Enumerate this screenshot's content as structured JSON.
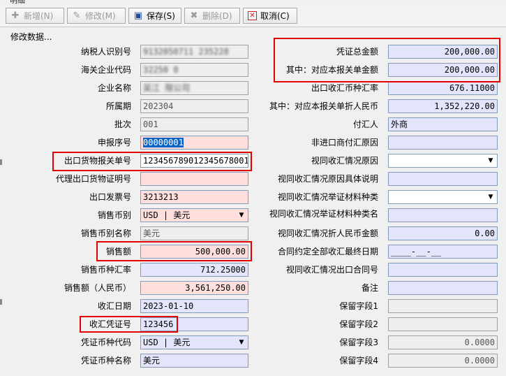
{
  "window": {
    "title": "明细"
  },
  "toolbar": {
    "add_label": "新增(N)",
    "edit_label": "修改(M)",
    "save_label": "保存(S)",
    "delete_label": "删除(D)",
    "cancel_label": "取消(C)"
  },
  "caption": "修改数据...",
  "left": {
    "taxpayer_id": {
      "label": "纳税人识别号",
      "value": "9132050711 235228"
    },
    "customs_code": {
      "label": "海关企业代码",
      "value": "32250 0"
    },
    "company_name": {
      "label": "企业名称",
      "value": "吴江 限公司"
    },
    "period": {
      "label": "所属期",
      "value": "202304"
    },
    "batch": {
      "label": "批次",
      "value": "001"
    },
    "declare_no": {
      "label": "申报序号",
      "value": "00000001"
    },
    "export_declaration_no": {
      "label": "出口货物报关单号",
      "value": "123456789012345678001"
    },
    "agent_cert_no": {
      "label": "代理出口货物证明号",
      "value": ""
    },
    "invoice_no": {
      "label": "出口发票号",
      "value": "3213213"
    },
    "sales_currency": {
      "label": "销售币别",
      "value": "USD | 美元"
    },
    "sales_currency_name": {
      "label": "销售币别名称",
      "value": "美元"
    },
    "sales_amount": {
      "label": "销售额",
      "value": "500,000.00"
    },
    "sales_rate": {
      "label": "销售币种汇率",
      "value": "712.25000"
    },
    "sales_amount_rmb": {
      "label": "销售额（人民币）",
      "value": "3,561,250.00"
    },
    "collection_date": {
      "label": "收汇日期",
      "value": "2023-01-10"
    },
    "collection_voucher": {
      "label": "收汇凭证号",
      "value": "123456"
    },
    "voucher_currency": {
      "label": "凭证币种代码",
      "value": "USD | 美元"
    },
    "voucher_currency_name": {
      "label": "凭证币种名称",
      "value": "美元"
    }
  },
  "right": {
    "voucher_total": {
      "label": "凭证总金额",
      "value": "200,000.00"
    },
    "declaration_amount": {
      "label": "其中：对应本报关单金额",
      "value": "200,000.00"
    },
    "export_rate": {
      "label": "出口收汇币种汇率",
      "value": "676.11000"
    },
    "declaration_rmb": {
      "label": "其中：对应本报关单折人民币",
      "value": "1,352,220.00"
    },
    "payer": {
      "label": "付汇人",
      "value": "外商"
    },
    "non_importer_reason": {
      "label": "非进口商付汇原因",
      "value": ""
    },
    "deemed_reason": {
      "label": "视同收汇情况原因",
      "value": ""
    },
    "deemed_reason_detail": {
      "label": "视同收汇情况原因具体说明",
      "value": ""
    },
    "deemed_material_type": {
      "label": "视同收汇情况举证材料种类",
      "value": ""
    },
    "deemed_material_name": {
      "label": "视同收汇情况举证材料种类名",
      "value": ""
    },
    "deemed_rmb": {
      "label": "视同收汇情况折人民币金额",
      "value": "0.00"
    },
    "contract_final_date": {
      "label": "合同约定全部收汇最终日期",
      "value": "____-__-__"
    },
    "deemed_contract_no": {
      "label": "视同收汇情况出口合同号",
      "value": ""
    },
    "remark": {
      "label": "备注",
      "value": ""
    },
    "reserve1": {
      "label": "保留字段1",
      "value": ""
    },
    "reserve2": {
      "label": "保留字段2",
      "value": ""
    },
    "reserve3": {
      "label": "保留字段3",
      "value": "0.0000"
    },
    "reserve4": {
      "label": "保留字段4",
      "value": "0.0000"
    }
  },
  "colors": {
    "highlight_border": "#e00000",
    "pink_field": "#ffdede",
    "blue_field": "#e4e4fb",
    "selection": "#0a64c8"
  },
  "icons": [
    "add-icon",
    "edit-icon",
    "save-icon",
    "delete-icon",
    "cancel-icon"
  ]
}
